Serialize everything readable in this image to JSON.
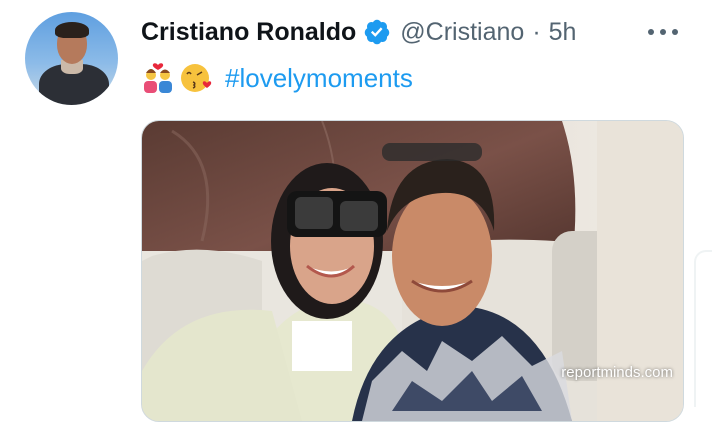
{
  "tweet": {
    "author_name": "Cristiano Ronaldo",
    "handle": "@Cristiano",
    "separator": "·",
    "timestamp": "5h",
    "emojis": [
      "couple-with-heart-emoji",
      "face-blowing-kiss-emoji"
    ],
    "hashtag": "#lovelymoments"
  },
  "media": {
    "watermark": "reportminds.com"
  },
  "colors": {
    "verified_badge": "#1d9bf0",
    "hashtag": "#1d9bf0",
    "secondary_text": "#536471"
  },
  "icons": {
    "verified": "verified-badge-icon",
    "more": "more-options-icon"
  }
}
